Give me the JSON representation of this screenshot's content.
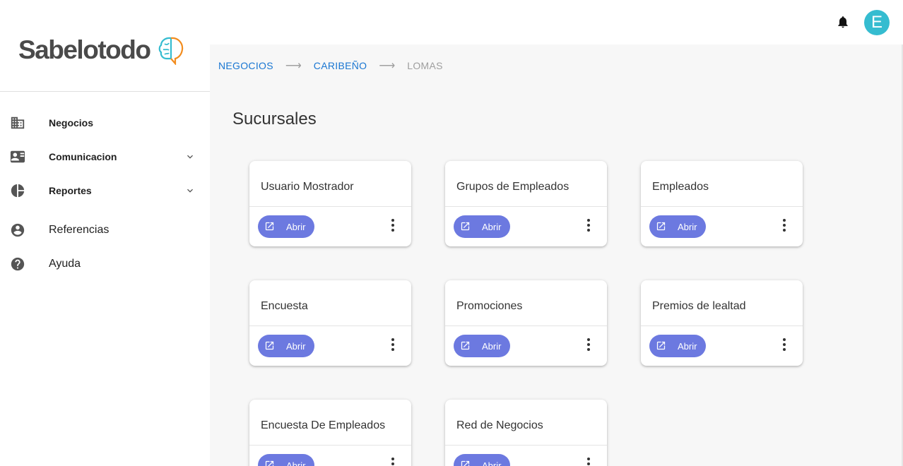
{
  "app": {
    "brand": "Sabelotodo"
  },
  "header": {
    "avatar_letter": "E"
  },
  "sidebar": {
    "items": [
      {
        "label": "Negocios"
      },
      {
        "label": "Comunicacion"
      },
      {
        "label": "Reportes"
      },
      {
        "label": "Referencias"
      },
      {
        "label": "Ayuda"
      }
    ]
  },
  "breadcrumb": {
    "items": [
      "NEGOCIOS",
      "CARIBEÑO",
      "LOMAS"
    ]
  },
  "page": {
    "title": "Sucursales"
  },
  "cards": [
    {
      "title": "Usuario Mostrador",
      "button": "Abrir"
    },
    {
      "title": "Grupos de Empleados",
      "button": "Abrir"
    },
    {
      "title": "Empleados",
      "button": "Abrir"
    },
    {
      "title": "Encuesta",
      "button": "Abrir"
    },
    {
      "title": "Promociones",
      "button": "Abrir"
    },
    {
      "title": "Premios de lealtad",
      "button": "Abrir"
    },
    {
      "title": "Encuesta De Empleados",
      "button": "Abrir"
    },
    {
      "title": "Red de Negocios",
      "button": "Abrir"
    }
  ],
  "colors": {
    "accent": "#1976d2",
    "button": "#6c79e0",
    "avatar": "#35bcd0"
  }
}
